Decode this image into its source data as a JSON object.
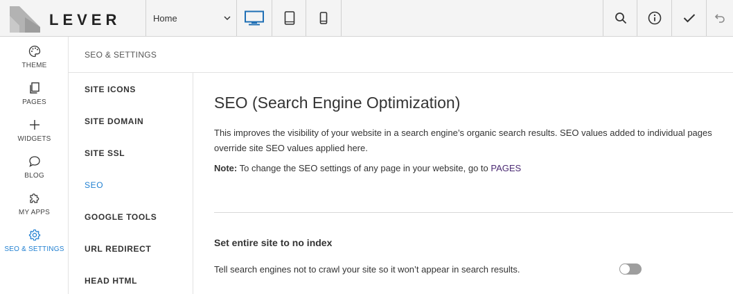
{
  "app": {
    "logo_text": "LEVER"
  },
  "topbar": {
    "page_select_value": "Home",
    "devices": [
      "desktop-icon",
      "tablet-icon",
      "mobile-icon"
    ],
    "tools": [
      "search-icon",
      "info-icon",
      "check-icon",
      "undo-icon"
    ]
  },
  "nav": {
    "items": [
      {
        "label": "THEME",
        "icon": "palette-icon"
      },
      {
        "label": "PAGES",
        "icon": "pages-icon"
      },
      {
        "label": "WIDGETS",
        "icon": "plus-icon"
      },
      {
        "label": "BLOG",
        "icon": "chat-bubble-icon"
      },
      {
        "label": "MY APPS",
        "icon": "puzzle-icon"
      },
      {
        "label": "SEO & SETTINGS",
        "icon": "gear-icon"
      }
    ],
    "active": "SEO & SETTINGS"
  },
  "settings": {
    "header": "SEO & SETTINGS",
    "items": [
      "SITE ICONS",
      "SITE DOMAIN",
      "SITE SSL",
      "SEO",
      "GOOGLE TOOLS",
      "URL REDIRECT",
      "HEAD HTML"
    ],
    "active": "SEO"
  },
  "main": {
    "title": "SEO (Search Engine Optimization)",
    "description": "This improves the visibility of your website in a search engine’s organic search results. SEO values added to individual pages override site SEO values applied here.",
    "note_label": "Note:",
    "note_text": " To change the SEO settings of any page in your website, go to ",
    "note_link": "PAGES",
    "section_title": "Set entire site to no index",
    "toggle_text": "Tell search engines not to crawl your site so it won’t appear in search results.",
    "toggle_on": false
  },
  "colors": {
    "accent": "#1f7fd1",
    "link": "#4b2a73",
    "topbar_bg": "#f4f4f4"
  }
}
